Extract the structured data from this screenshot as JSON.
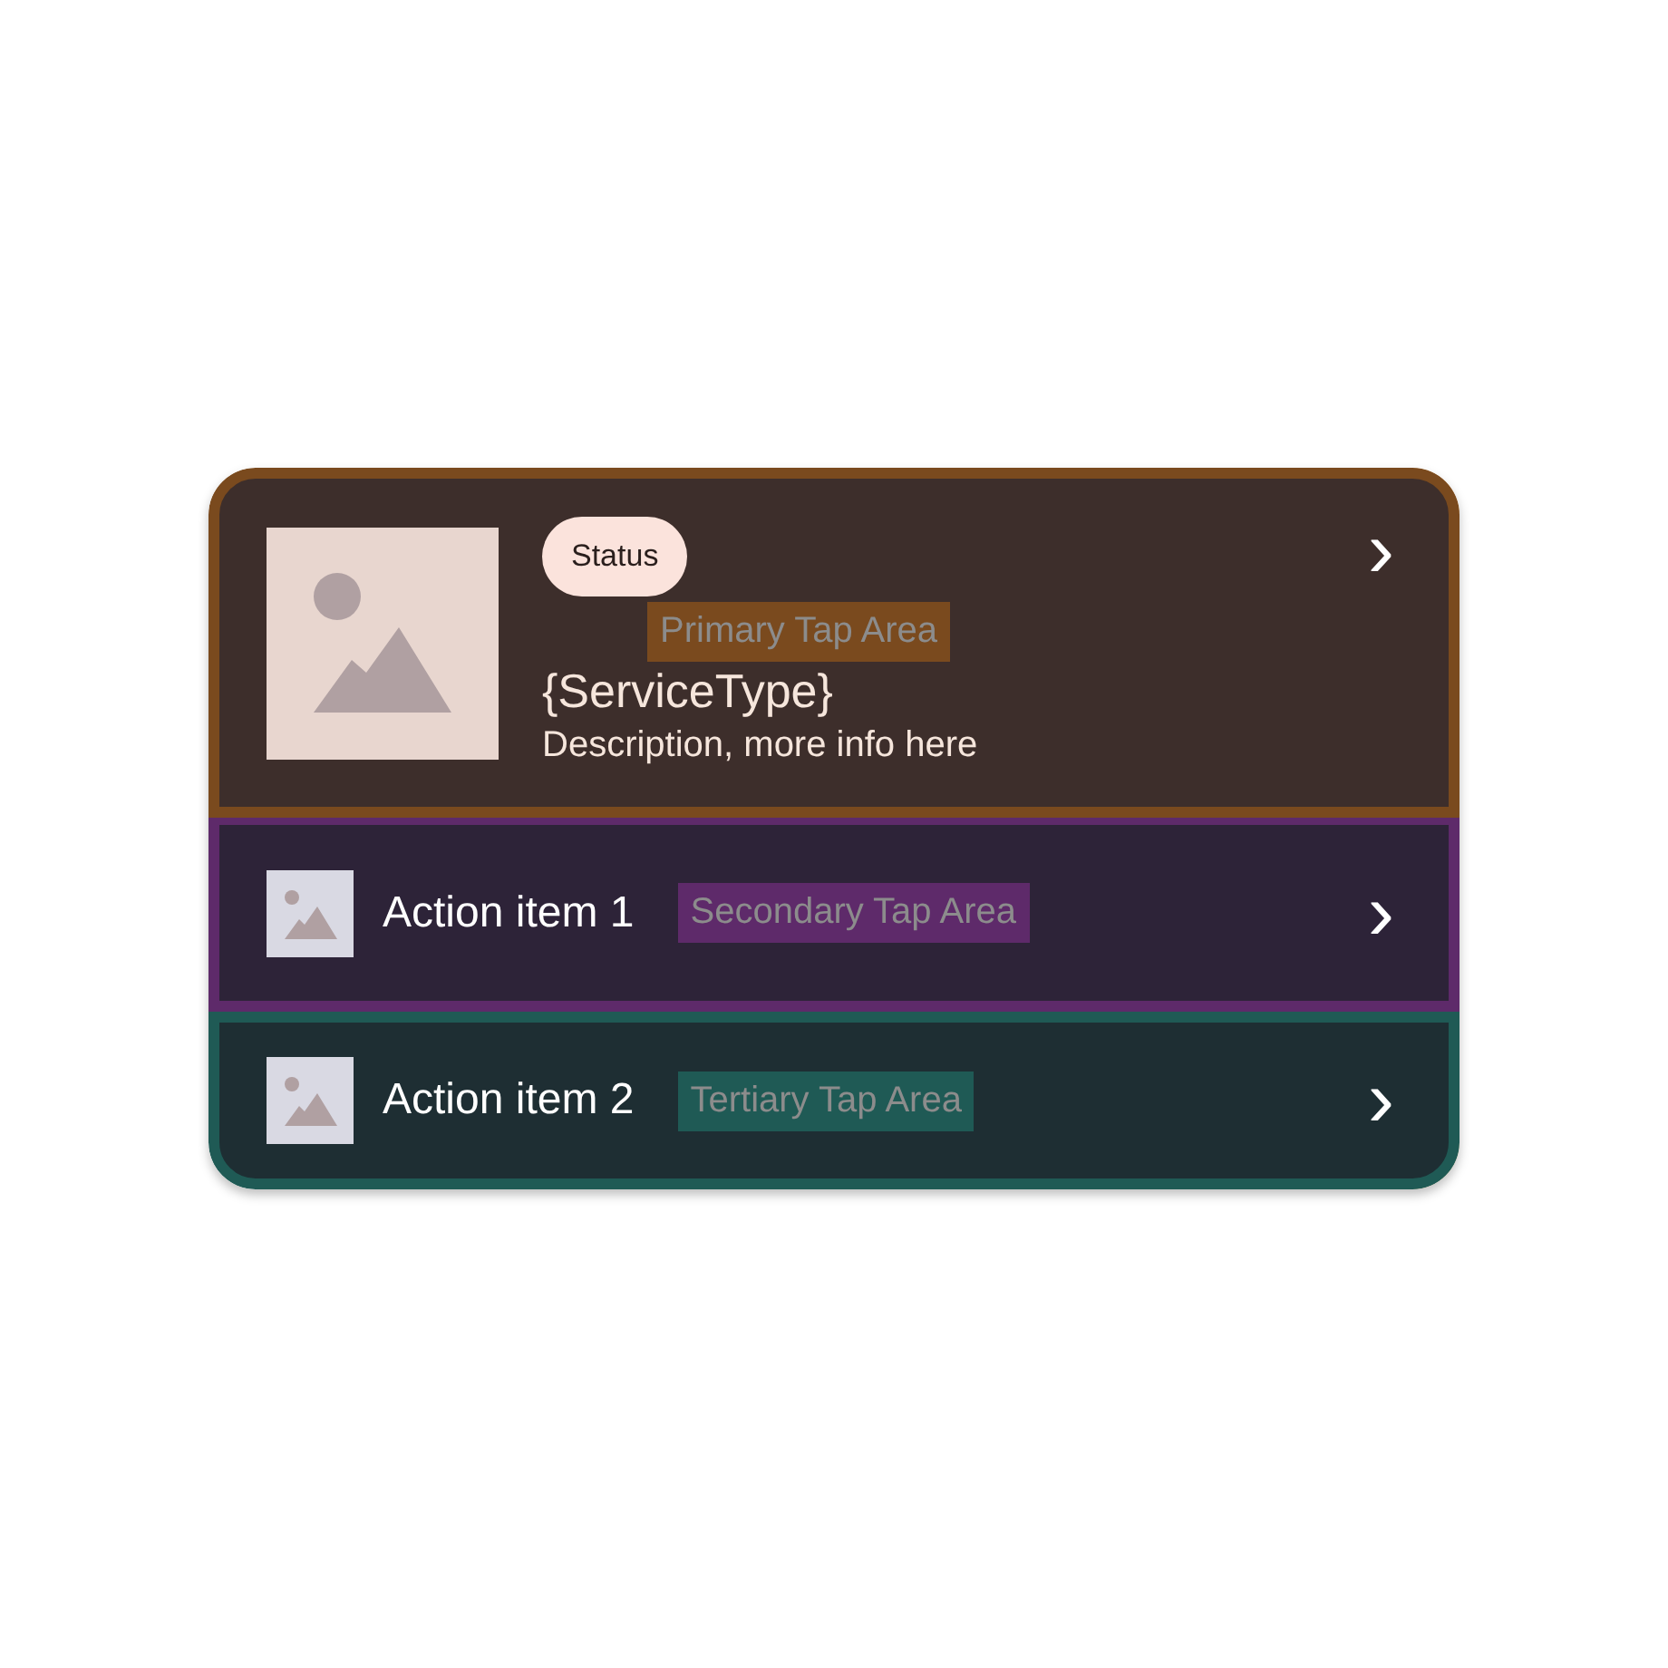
{
  "card": {
    "primary": {
      "color": "#7a4a1e",
      "status": "Status",
      "title": "{ServiceType}",
      "description": "Description, more info here",
      "chevron": "›",
      "annotation": "Primary Tap Area"
    },
    "actions": [
      {
        "label": "Action item 1",
        "color": "#5e2a6a",
        "chevron": "›",
        "annotation": "Secondary Tap Area"
      },
      {
        "label": "Action item 2",
        "color": "#1f5a55",
        "chevron": "›",
        "annotation": "Tertiary Tap Area"
      }
    ]
  }
}
